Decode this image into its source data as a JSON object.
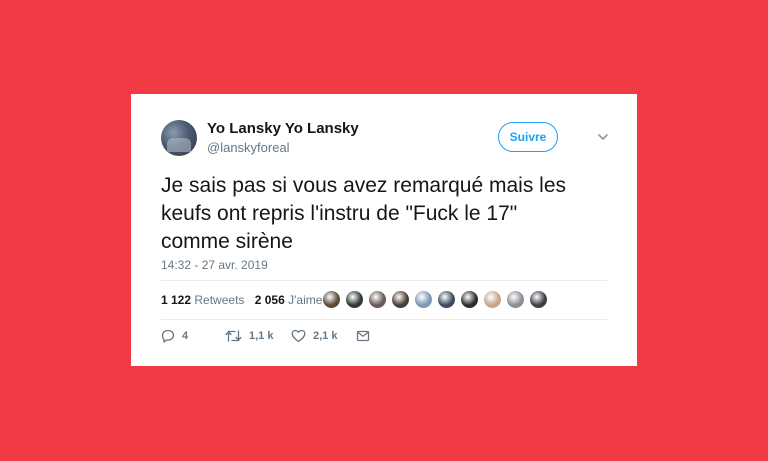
{
  "tweet": {
    "display_name": "Yo Lansky Yo Lansky",
    "handle": "@lanskyforeal",
    "follow_label": "Suivre",
    "text": "Je sais pas si vous avez remarqué mais les\nkeufs ont repris l'instru de \"Fuck le 17\"\ncomme sirène",
    "timestamp": "14:32 - 27 avr. 2019",
    "retweets_count": "1 122",
    "retweets_label": "Retweets",
    "likes_count": "2 056",
    "likes_label": "J'aime",
    "reply_count": "4",
    "retweet_action_count": "1,1 k",
    "like_action_count": "2,1 k"
  },
  "liker_avatars": [
    "#5d4a3a",
    "#2f3b33",
    "#6b5b57",
    "#4a3f34",
    "#7e98b3",
    "#3d4c5e",
    "#2d2d2d",
    "#c9a58a",
    "#8a8f96",
    "#3b3f47"
  ],
  "icons": {
    "reply": "reply-icon",
    "retweet": "retweet-icon",
    "like": "heart-icon",
    "message": "envelope-icon",
    "more": "chevron-down-icon"
  },
  "colors": {
    "background": "#f23a45",
    "accent": "#1da1f2",
    "text": "#14171a",
    "muted": "#657786"
  }
}
